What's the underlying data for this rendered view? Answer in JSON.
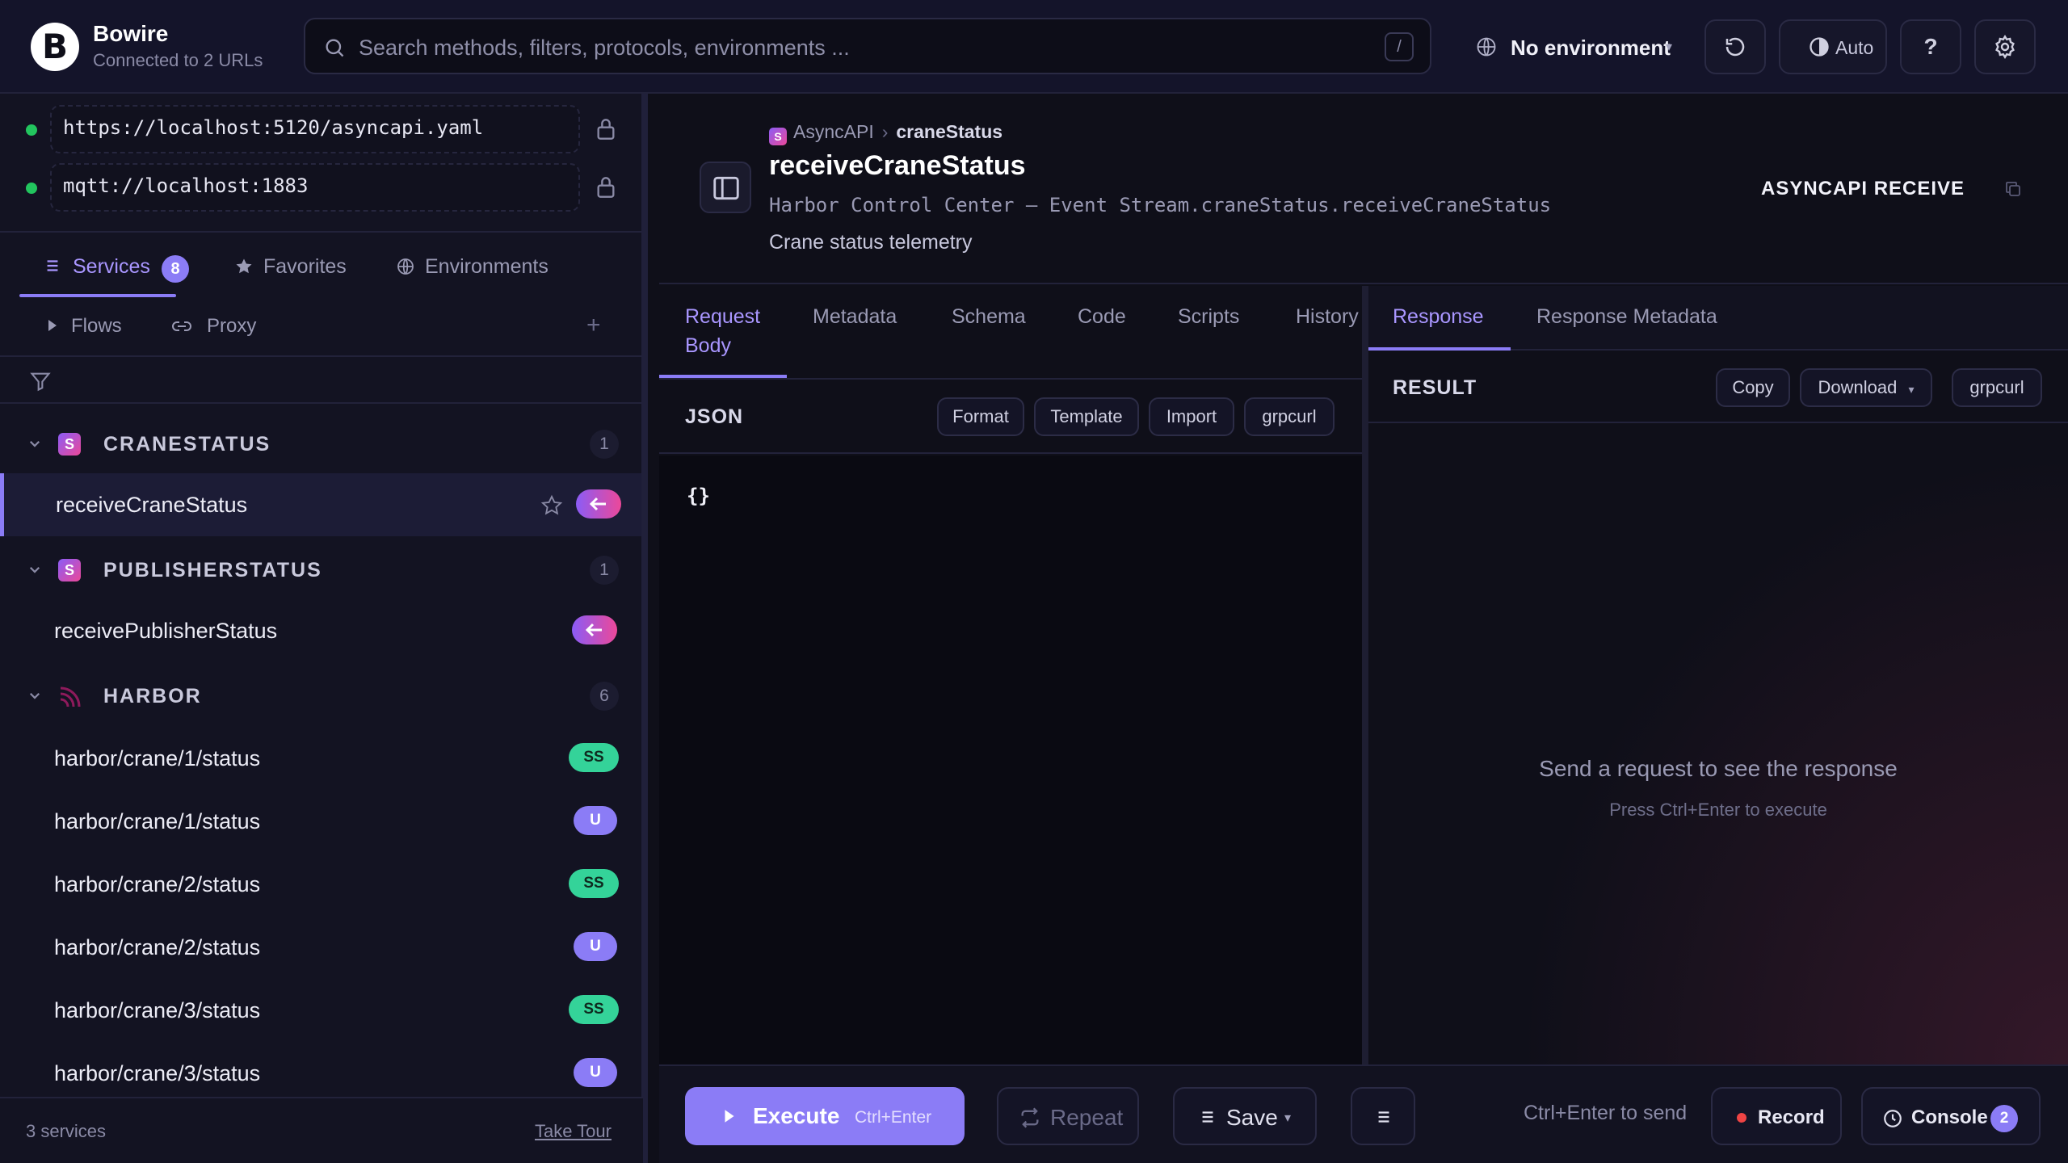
{
  "app": {
    "title": "Bowire",
    "subtitle": "Connected to 2 URLs",
    "logo_letter": "B"
  },
  "search": {
    "placeholder": "Search methods, filters, protocols, environments ...",
    "shortcut": "/"
  },
  "environment": {
    "label": "No environment"
  },
  "toolbar": {
    "theme_label": "Auto",
    "help_label": "?"
  },
  "urls": [
    {
      "url": "https://localhost:5120/asyncapi.yaml",
      "status": "connected",
      "status_color": "#22c55e"
    },
    {
      "url": "mqtt://localhost:1883",
      "status": "connected",
      "status_color": "#22c55e"
    }
  ],
  "sidebar": {
    "tabs": [
      {
        "label": "Services",
        "badge": "8",
        "active": true
      },
      {
        "label": "Favorites"
      },
      {
        "label": "Environments"
      }
    ],
    "sub": {
      "flows_label": "Flows",
      "proxy_label": "Proxy",
      "add_label": "+"
    },
    "groups": [
      {
        "name": "CRANESTATUS",
        "count": "1",
        "icon": "asyncapi-icon",
        "items": [
          {
            "label": "receiveCraneStatus",
            "badge": "receive",
            "active": true
          }
        ]
      },
      {
        "name": "PUBLISHERSTATUS",
        "count": "1",
        "icon": "asyncapi-icon",
        "items": [
          {
            "label": "receivePublisherStatus",
            "badge": "receive"
          }
        ]
      },
      {
        "name": "HARBOR",
        "count": "6",
        "icon": "mqtt-icon",
        "items": [
          {
            "label": "harbor/crane/1/status",
            "badge": "SS"
          },
          {
            "label": "harbor/crane/1/status",
            "badge": "U"
          },
          {
            "label": "harbor/crane/2/status",
            "badge": "SS"
          },
          {
            "label": "harbor/crane/2/status",
            "badge": "U"
          },
          {
            "label": "harbor/crane/3/status",
            "badge": "SS"
          },
          {
            "label": "harbor/crane/3/status",
            "badge": "U"
          }
        ]
      }
    ],
    "footer": {
      "count": "3 services",
      "tour": "Take Tour"
    }
  },
  "method": {
    "breadcrumb_protocol": "AsyncAPI",
    "breadcrumb_sep": "›",
    "breadcrumb_service": "craneStatus",
    "title": "receiveCraneStatus",
    "path": "Harbor Control Center — Event Stream.craneStatus.receiveCraneStatus",
    "description": "Crane status telemetry",
    "kind": "ASYNCAPI RECEIVE"
  },
  "request": {
    "tabs": [
      {
        "label": "Request Body",
        "active": true
      },
      {
        "label": "Metadata"
      },
      {
        "label": "Schema"
      },
      {
        "label": "Code"
      },
      {
        "label": "Scripts"
      },
      {
        "label": "History"
      }
    ],
    "format_label": "JSON",
    "actions": [
      "Format",
      "Template",
      "Import",
      "grpcurl"
    ],
    "body": "{}"
  },
  "response": {
    "tabs": [
      {
        "label": "Response",
        "active": true
      },
      {
        "label": "Response Metadata"
      }
    ],
    "result_label": "RESULT",
    "actions": {
      "copy": "Copy",
      "download": "Download",
      "grpcurl": "grpcurl"
    },
    "empty_text": "Send a request to see the response",
    "empty_hint": "Press Ctrl+Enter to execute"
  },
  "bottombar": {
    "execute_label": "Execute",
    "execute_shortcut": "Ctrl+Enter",
    "repeat_label": "Repeat",
    "save_label": "Save",
    "hint": "Ctrl+Enter to send",
    "record_label": "Record",
    "console_label": "Console",
    "console_badge": "2"
  },
  "colors": {
    "accent": "#8b7cf6",
    "background": "#0f0f19",
    "connected": "#22c55e",
    "badge_ss": "#34d399",
    "record": "#ef4444"
  }
}
